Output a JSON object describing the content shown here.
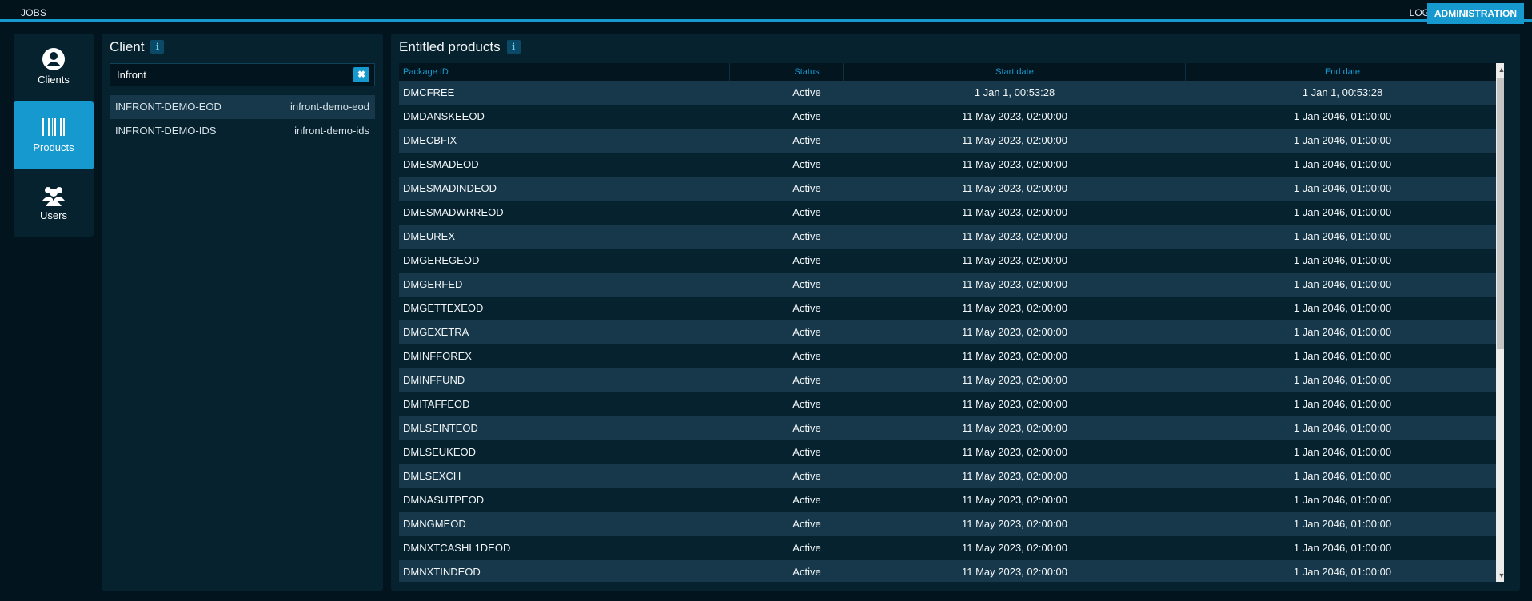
{
  "topbar": {
    "jobs": "JOBS",
    "logs": "LOGS",
    "administration": "ADMINISTRATION"
  },
  "nav": [
    {
      "label": "Clients",
      "icon": "user-icon"
    },
    {
      "label": "Products",
      "icon": "barcode-icon"
    },
    {
      "label": "Users",
      "icon": "users-icon"
    }
  ],
  "client_panel": {
    "title": "Client",
    "info_icon": "i",
    "search_value": "Infront",
    "clear_icon": "✖",
    "clients": [
      {
        "name": "INFRONT-DEMO-EOD",
        "id": "infront-demo-eod"
      },
      {
        "name": "INFRONT-DEMO-IDS",
        "id": "infront-demo-ids"
      }
    ]
  },
  "products_panel": {
    "title": "Entitled products",
    "info_icon": "i",
    "columns": [
      "Package ID",
      "Status",
      "Start date",
      "End date"
    ],
    "rows": [
      {
        "id": "DMCFREE",
        "status": "Active",
        "start": "1 Jan 1, 00:53:28",
        "end": "1 Jan 1, 00:53:28"
      },
      {
        "id": "DMDANSKEEOD",
        "status": "Active",
        "start": "11 May 2023, 02:00:00",
        "end": "1 Jan 2046, 01:00:00"
      },
      {
        "id": "DMECBFIX",
        "status": "Active",
        "start": "11 May 2023, 02:00:00",
        "end": "1 Jan 2046, 01:00:00"
      },
      {
        "id": "DMESMADEOD",
        "status": "Active",
        "start": "11 May 2023, 02:00:00",
        "end": "1 Jan 2046, 01:00:00"
      },
      {
        "id": "DMESMADINDEOD",
        "status": "Active",
        "start": "11 May 2023, 02:00:00",
        "end": "1 Jan 2046, 01:00:00"
      },
      {
        "id": "DMESMADWRREOD",
        "status": "Active",
        "start": "11 May 2023, 02:00:00",
        "end": "1 Jan 2046, 01:00:00"
      },
      {
        "id": "DMEUREX",
        "status": "Active",
        "start": "11 May 2023, 02:00:00",
        "end": "1 Jan 2046, 01:00:00"
      },
      {
        "id": "DMGEREGEOD",
        "status": "Active",
        "start": "11 May 2023, 02:00:00",
        "end": "1 Jan 2046, 01:00:00"
      },
      {
        "id": "DMGERFED",
        "status": "Active",
        "start": "11 May 2023, 02:00:00",
        "end": "1 Jan 2046, 01:00:00"
      },
      {
        "id": "DMGETTEXEOD",
        "status": "Active",
        "start": "11 May 2023, 02:00:00",
        "end": "1 Jan 2046, 01:00:00"
      },
      {
        "id": "DMGEXETRA",
        "status": "Active",
        "start": "11 May 2023, 02:00:00",
        "end": "1 Jan 2046, 01:00:00"
      },
      {
        "id": "DMINFFOREX",
        "status": "Active",
        "start": "11 May 2023, 02:00:00",
        "end": "1 Jan 2046, 01:00:00"
      },
      {
        "id": "DMINFFUND",
        "status": "Active",
        "start": "11 May 2023, 02:00:00",
        "end": "1 Jan 2046, 01:00:00"
      },
      {
        "id": "DMITAFFEOD",
        "status": "Active",
        "start": "11 May 2023, 02:00:00",
        "end": "1 Jan 2046, 01:00:00"
      },
      {
        "id": "DMLSEINTEOD",
        "status": "Active",
        "start": "11 May 2023, 02:00:00",
        "end": "1 Jan 2046, 01:00:00"
      },
      {
        "id": "DMLSEUKEOD",
        "status": "Active",
        "start": "11 May 2023, 02:00:00",
        "end": "1 Jan 2046, 01:00:00"
      },
      {
        "id": "DMLSEXCH",
        "status": "Active",
        "start": "11 May 2023, 02:00:00",
        "end": "1 Jan 2046, 01:00:00"
      },
      {
        "id": "DMNASUTPEOD",
        "status": "Active",
        "start": "11 May 2023, 02:00:00",
        "end": "1 Jan 2046, 01:00:00"
      },
      {
        "id": "DMNGMEOD",
        "status": "Active",
        "start": "11 May 2023, 02:00:00",
        "end": "1 Jan 2046, 01:00:00"
      },
      {
        "id": "DMNXTCASHL1DEOD",
        "status": "Active",
        "start": "11 May 2023, 02:00:00",
        "end": "1 Jan 2046, 01:00:00"
      },
      {
        "id": "DMNXTINDEOD",
        "status": "Active",
        "start": "11 May 2023, 02:00:00",
        "end": "1 Jan 2046, 01:00:00"
      }
    ]
  },
  "colors": {
    "accent": "#1599cf",
    "background": "#02141d",
    "panel": "#06222f",
    "row_alt": "#17384a"
  }
}
